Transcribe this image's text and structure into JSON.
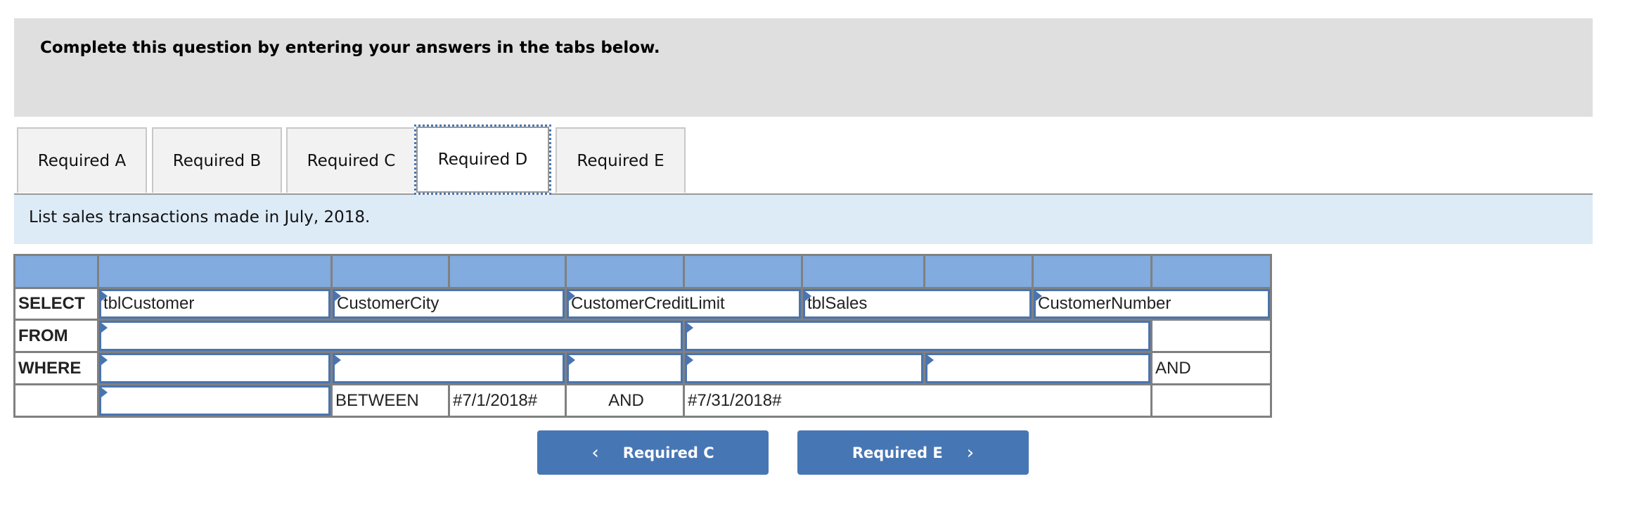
{
  "instructions": {
    "title": "Complete this question by entering your answers in the tabs below."
  },
  "tabs": [
    {
      "label": "Required A",
      "active": false
    },
    {
      "label": "Required B",
      "active": false
    },
    {
      "label": "Required C",
      "active": false
    },
    {
      "label": "Required D",
      "active": true
    },
    {
      "label": "Required E",
      "active": false
    }
  ],
  "prompt": "List sales transactions made in July, 2018.",
  "sql": {
    "keywords": {
      "select": "SELECT",
      "from": "FROM",
      "where": "WHERE"
    },
    "select_values": [
      "tblCustomer",
      "CustomerCity",
      "CustomerCreditLimit",
      "tblSales",
      "CustomerNumber"
    ],
    "from_values": [
      "",
      ""
    ],
    "where_values": [
      "",
      "",
      "",
      "",
      ""
    ],
    "where_suffix": "AND",
    "last_row": {
      "input_value": "",
      "between": "BETWEEN",
      "start_date": "#7/1/2018#",
      "and": "AND",
      "end_date": "#7/31/2018#"
    }
  },
  "nav": {
    "prev_label": "Required C",
    "next_label": "Required E",
    "prev_icon": "chevron-left-icon",
    "next_icon": "chevron-right-icon"
  },
  "colors": {
    "accent": "#4776b4",
    "header_fill": "#82abdf",
    "prompt_fill": "#ddebf7",
    "instructions_fill": "#dfdfdf"
  }
}
